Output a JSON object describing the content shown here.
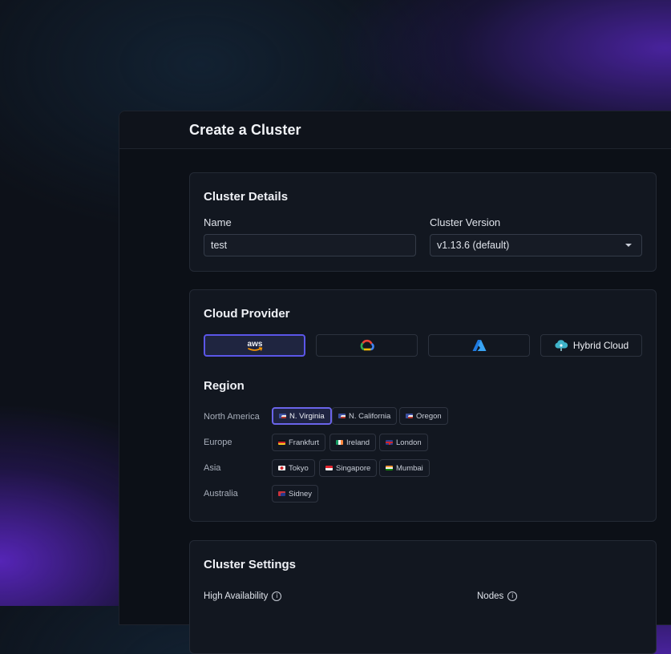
{
  "page": {
    "title": "Create a Cluster"
  },
  "cluster_details": {
    "title": "Cluster Details",
    "name_label": "Name",
    "name_value": "test",
    "version_label": "Cluster Version",
    "version_value": "v1.13.6 (default)"
  },
  "cloud_provider": {
    "title": "Cloud Provider",
    "providers": [
      {
        "icon": "aws-logo-icon",
        "label": "aws",
        "selected": true
      },
      {
        "icon": "google-cloud-logo-icon",
        "label": "",
        "selected": false
      },
      {
        "icon": "azure-logo-icon",
        "label": "",
        "selected": false
      },
      {
        "icon": "hybrid-cloud-icon",
        "label": "Hybrid Cloud",
        "selected": false
      }
    ]
  },
  "region": {
    "title": "Region",
    "groups": [
      {
        "name": "North America",
        "items": [
          "N. Virginia",
          "N. California",
          "Oregon"
        ]
      },
      {
        "name": "Europe",
        "items": [
          "Frankfurt",
          "Ireland",
          "London"
        ]
      },
      {
        "name": "Asia",
        "items": [
          "Tokyo",
          "Singapore",
          "Mumbai"
        ]
      },
      {
        "name": "Australia",
        "items": [
          "Sidney"
        ]
      }
    ],
    "selected": "N. Virginia"
  },
  "cluster_settings": {
    "title": "Cluster Settings",
    "high_availability_label": "High Availability",
    "nodes_label": "Nodes"
  },
  "colors": {
    "accent": "#5b56e8",
    "background": "#0c1017",
    "card": "#121720"
  }
}
